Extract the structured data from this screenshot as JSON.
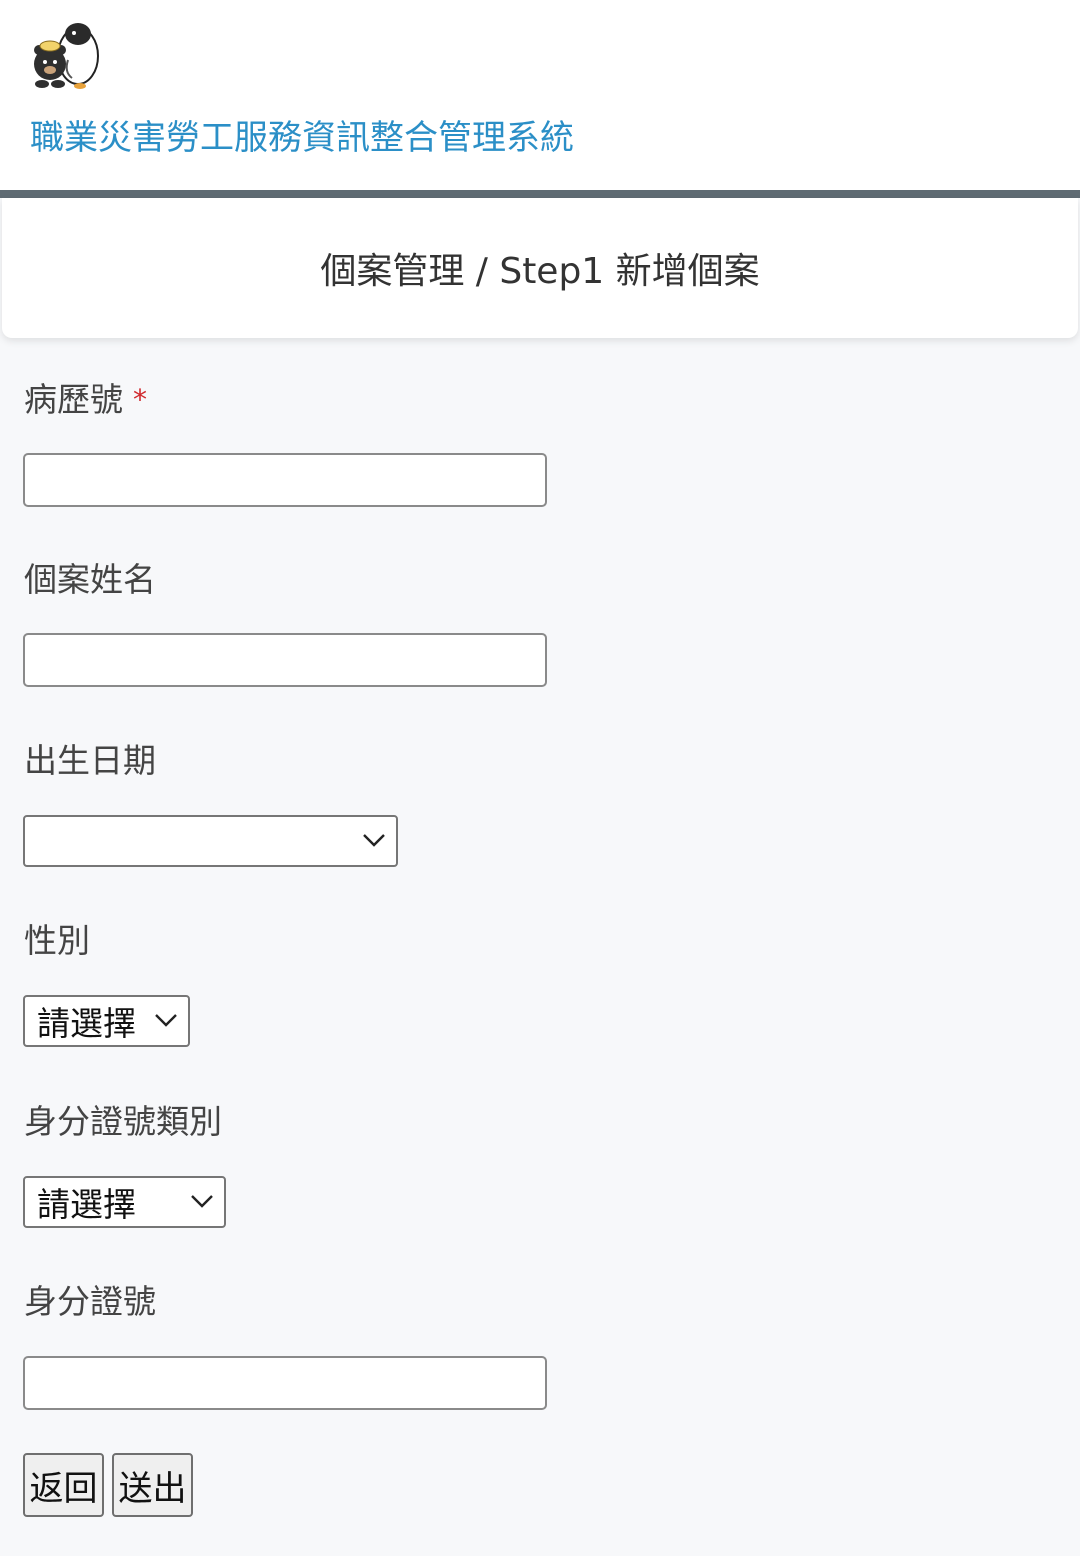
{
  "header": {
    "site_title": "職業災害勞工服務資訊整合管理系統",
    "logo_icon": "mascot-logo-icon"
  },
  "page": {
    "heading": "個案管理 / Step1 新增個案"
  },
  "form": {
    "medical_record": {
      "label": "病歷號",
      "required_mark": "*",
      "value": ""
    },
    "case_name": {
      "label": "個案姓名",
      "value": ""
    },
    "birth_date": {
      "label": "出生日期",
      "value": ""
    },
    "gender": {
      "label": "性別",
      "selected": "請選擇"
    },
    "id_type": {
      "label": "身分證號類別",
      "selected": "請選擇"
    },
    "id_number": {
      "label": "身分證號",
      "value": ""
    }
  },
  "actions": {
    "back_label": "返回",
    "submit_label": "送出"
  },
  "colors": {
    "brand_title": "#2b8fc7",
    "divider": "#5f6b73",
    "required": "#d0292d",
    "background": "#f7f8fa"
  }
}
